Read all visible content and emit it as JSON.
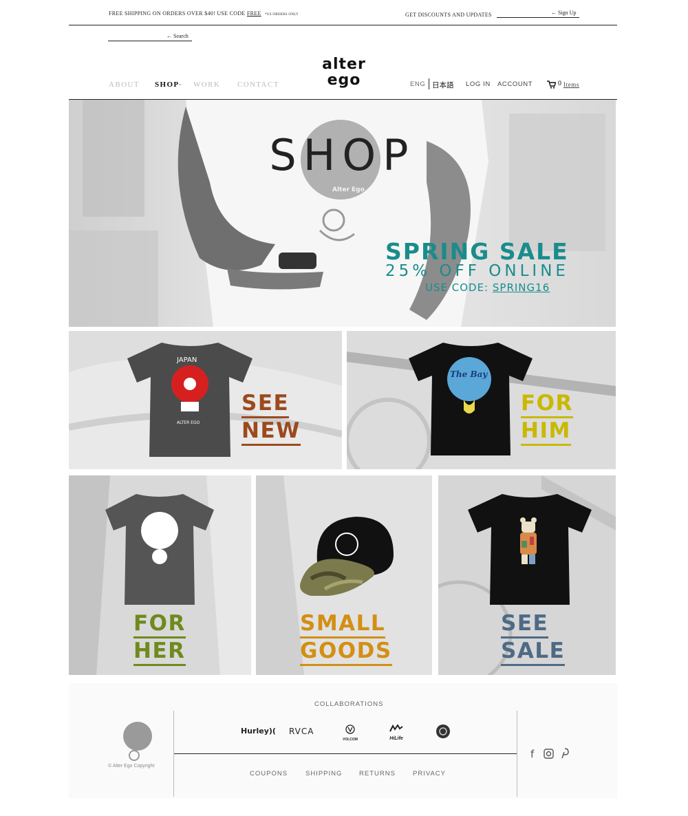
{
  "topbar": {
    "shipping_prefix": "FREE SHIPPING ON ORDERS OVER $40! USE CODE ",
    "shipping_code": "FREE",
    "shipping_note": "*US ORDERS ONLY",
    "signup_label": "GET DISCOUNTS AND UPDATES",
    "signup_button": "← Sign Up",
    "search_button": "← Search"
  },
  "logo": {
    "line1": "alter",
    "line2": "ego"
  },
  "nav": {
    "about": "ABOUT",
    "shop": "SHOP",
    "work": "WORK",
    "contact": "CONTACT"
  },
  "utility": {
    "lang_en": "ENG",
    "lang_jp": "日本語",
    "login": "LOG IN",
    "account": "ACCOUNT",
    "cart_count": "0",
    "cart_label": "Items"
  },
  "hero": {
    "title": "SHOP",
    "mascot_text": "Alter Ego",
    "sale_title": "SPRING SALE",
    "sale_sub": "25% OFF ONLINE",
    "code_prefix": "USE CODE: ",
    "code": "SPRING16"
  },
  "tiles": {
    "new": {
      "line1": "SEE",
      "line2": "NEW",
      "shirt_text": "JAPAN",
      "brand_text": "ALTER EGO"
    },
    "him": {
      "line1": "FOR",
      "line2": "HIM",
      "shirt_text": "The Bay"
    },
    "her": {
      "line1": "FOR",
      "line2": "HER"
    },
    "small": {
      "line1": "SMALL",
      "line2": "GOODS"
    },
    "sale": {
      "line1": "SEE",
      "line2": "SALE"
    }
  },
  "footer": {
    "collab_title": "COLLABORATIONS",
    "brands": [
      "Hurley",
      "RVCA",
      "VOLCOM",
      "HiLife"
    ],
    "links": [
      "COUPONS",
      "SHIPPING",
      "RETURNS",
      "PRIVACY"
    ],
    "copyright": "© Alter Ego Copyright"
  },
  "colors": {
    "teal": "#1a8c8c",
    "rust": "#9b4a1e",
    "mustard": "#c9b800",
    "olive": "#6f8a1d",
    "orange": "#d38f14",
    "slate": "#4d6a86"
  }
}
